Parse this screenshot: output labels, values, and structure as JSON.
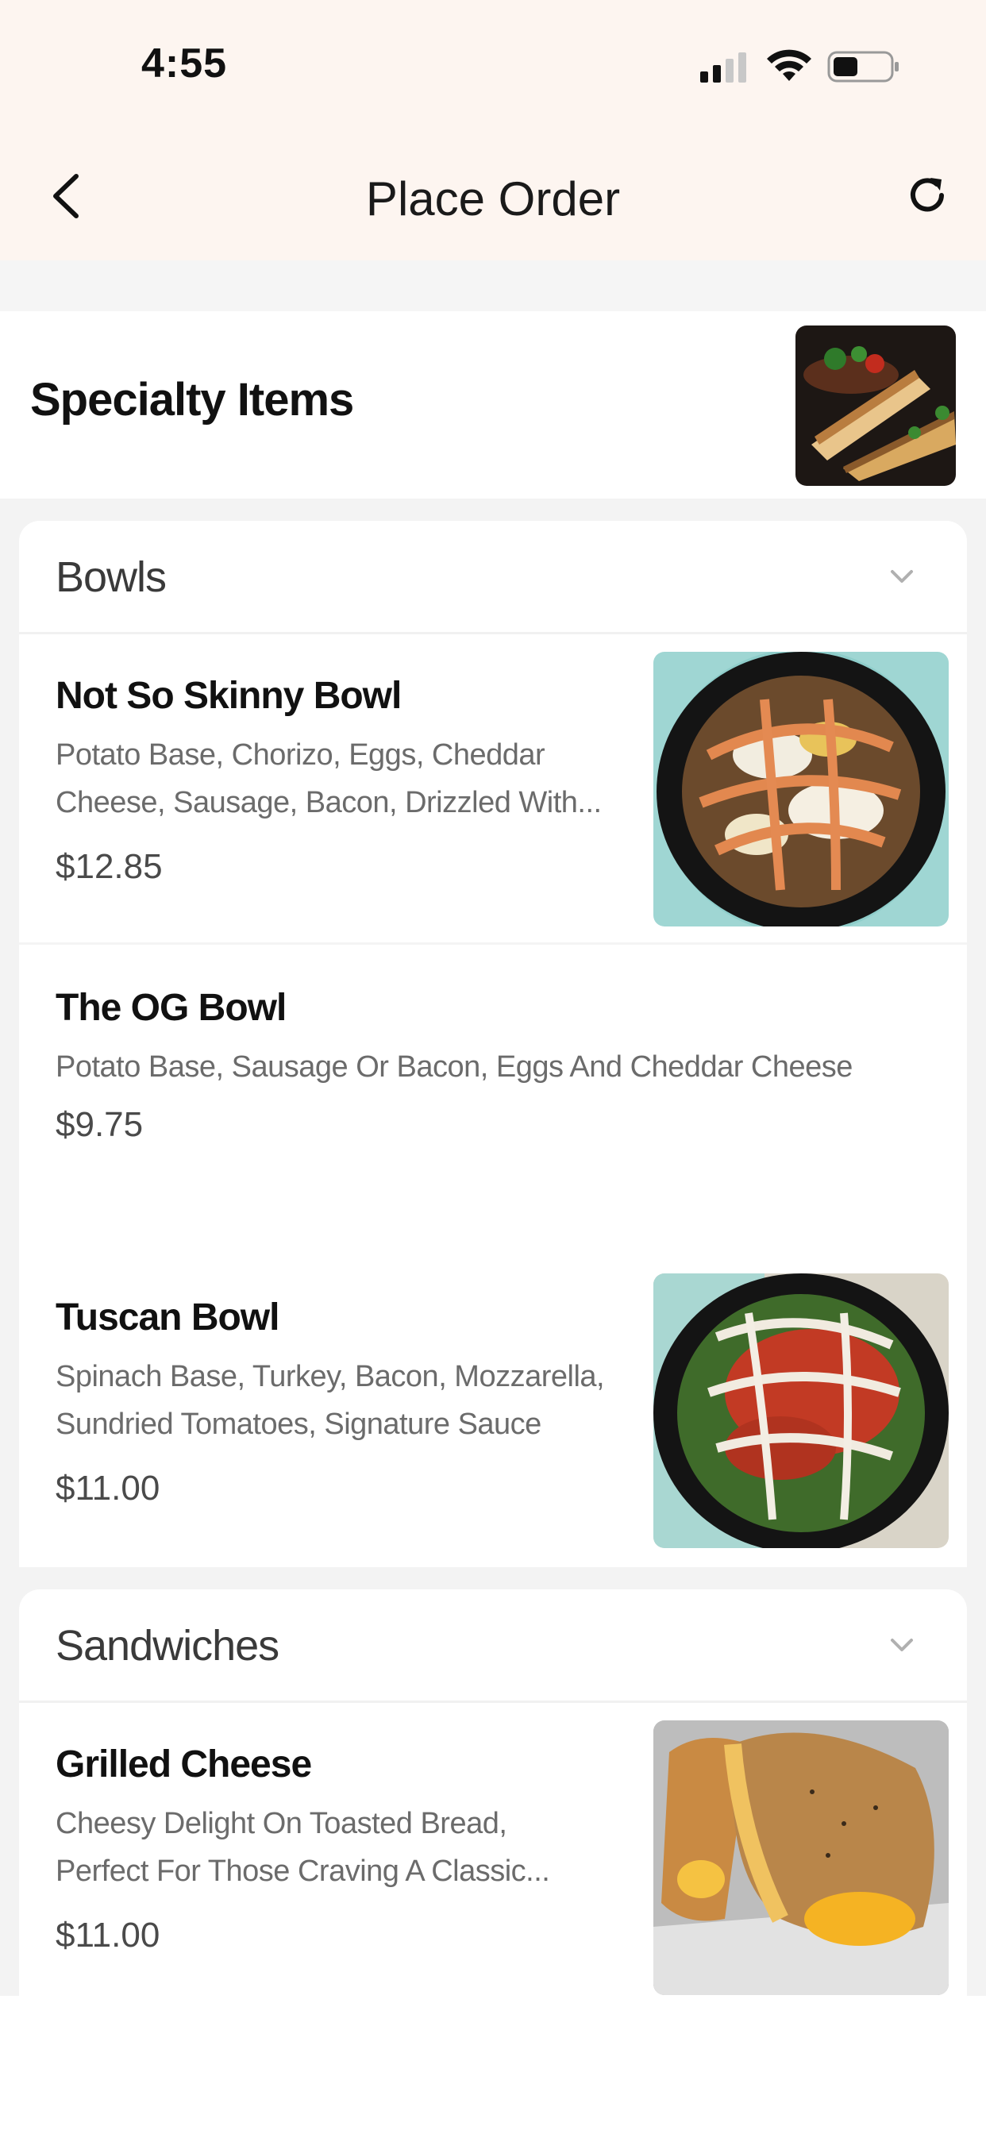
{
  "status_bar": {
    "time": "4:55"
  },
  "header": {
    "title": "Place Order"
  },
  "specialty": {
    "title": "Specialty Items"
  },
  "sections": [
    {
      "title": "Bowls",
      "items": [
        {
          "name": "Not So Skinny Bowl",
          "desc_line1": "Potato Base, Chorizo, Eggs, Cheddar",
          "desc_line2": "Cheese, Sausage, Bacon, Drizzled With...",
          "price": "$12.85"
        },
        {
          "name": "The OG Bowl",
          "desc_line1": "Potato Base, Sausage Or Bacon, Eggs And Cheddar Cheese",
          "price": "$9.75"
        },
        {
          "name": "Tuscan Bowl",
          "desc_line1": "Spinach Base, Turkey, Bacon, Mozzarella,",
          "desc_line2": "Sundried Tomatoes, Signature Sauce",
          "price": "$11.00"
        }
      ]
    },
    {
      "title": "Sandwiches",
      "items": [
        {
          "name": "Grilled Cheese",
          "desc_line1": "Cheesy Delight On Toasted Bread,",
          "desc_line2": "Perfect For Those Craving A Classic...",
          "price": "$11.00"
        }
      ]
    }
  ],
  "colors": {
    "header_bg": "#fdf5f0",
    "section_bg": "#f3f3f3",
    "text_muted": "#6b6b6b"
  }
}
